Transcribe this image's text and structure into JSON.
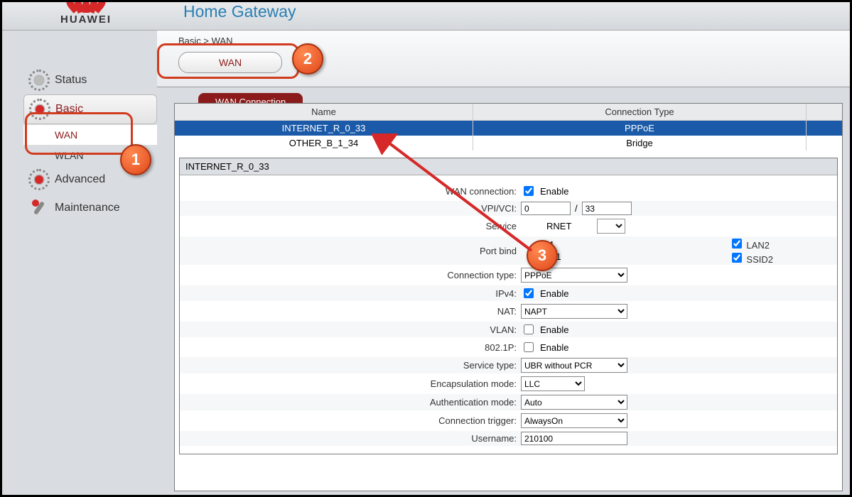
{
  "logo_text": "HUAWEI",
  "title": "Home Gateway",
  "breadcrumb": "Basic > WAN",
  "top_tab": "WAN",
  "nav": {
    "status": "Status",
    "basic": "Basic",
    "wan": "WAN",
    "wlan": "WLAN",
    "advanced": "Advanced",
    "maintenance": "Maintenance"
  },
  "section_title": "WAN Connection",
  "table": {
    "headers": {
      "name": "Name",
      "type": "Connection Type"
    },
    "rows": [
      {
        "name": "INTERNET_R_0_33",
        "type": "PPPoE"
      },
      {
        "name": "OTHER_B_1_34",
        "type": "Bridge"
      }
    ]
  },
  "detail_title": "INTERNET_R_0_33",
  "form": {
    "wan_connection_label": "WAN connection:",
    "enable": "Enable",
    "vpi_vci_label": "VPI/VCI:",
    "vpi": "0",
    "vci": "33",
    "service_label": "Service",
    "service_suffix": "RNET",
    "port_bind_label": "Port bind",
    "port_bind_opt1": "1",
    "port_bind_opt2": "D1",
    "lan2": "LAN2",
    "ssid2": "SSID2",
    "conn_type_label": "Connection type:",
    "conn_type": "PPPoE",
    "ipv4_label": "IPv4:",
    "nat_label": "NAT:",
    "nat": "NAPT",
    "vlan_label": "VLAN:",
    "8021p_label": "802.1P:",
    "svc_type_label": "Service type:",
    "svc_type": "UBR without PCR",
    "encap_label": "Encapsulation mode:",
    "encap": "LLC",
    "auth_label": "Authentication mode:",
    "auth": "Auto",
    "trigger_label": "Connection trigger:",
    "trigger": "AlwaysOn",
    "user_label": "Username:",
    "user": "210100"
  },
  "badges": {
    "b1": "1",
    "b2": "2",
    "b3": "3"
  }
}
